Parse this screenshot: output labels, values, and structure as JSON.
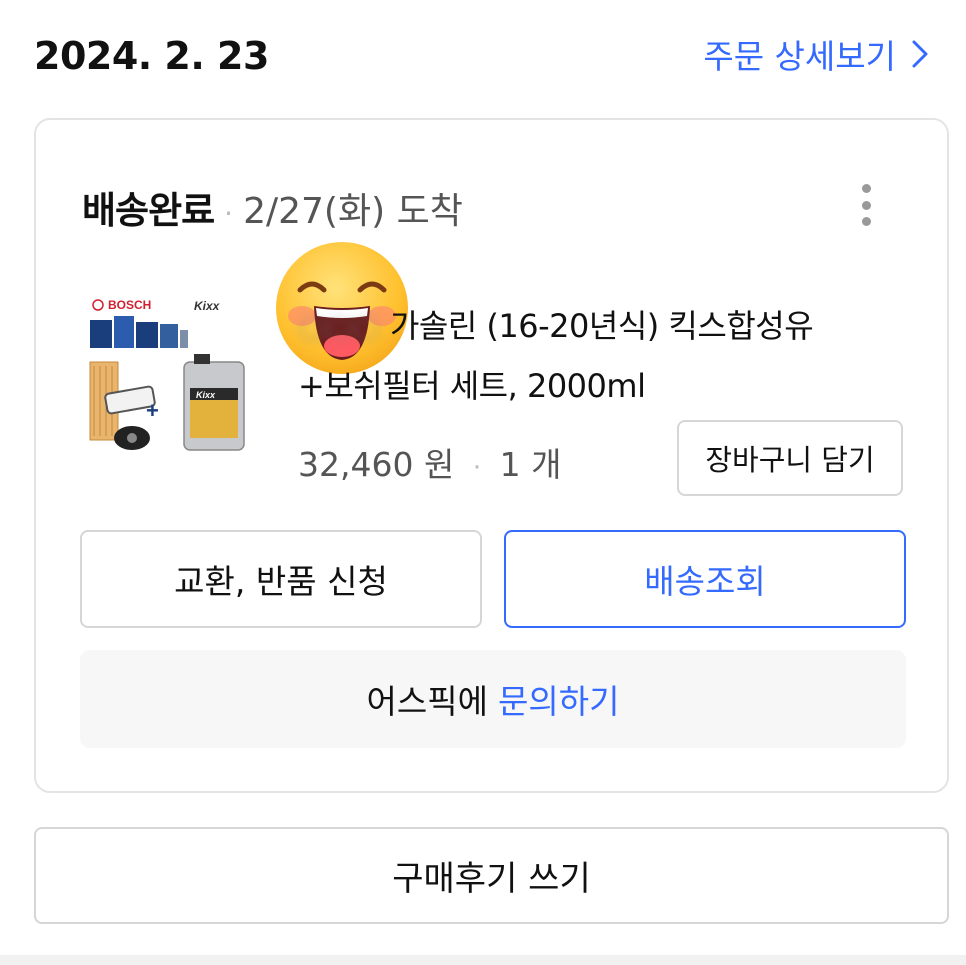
{
  "order": {
    "date": "2024. 2. 23",
    "detail_link": "주문 상세보기"
  },
  "shipment": {
    "status": "배송완료",
    "separator": "·",
    "arrival": "2/27(화) 도착"
  },
  "product": {
    "name_blurred": "○○○",
    "name_line1": "가솔린 (16-20년식) 킥스합성유",
    "name_line2": "+보쉬필터 세트, 2000ml",
    "price": "32,460 원",
    "quantity": "1 개",
    "image_brand_left": "BOSCH",
    "image_brand_right": "Kixx",
    "image_brand_small": "Kixx"
  },
  "buttons": {
    "add_to_cart": "장바구니 담기",
    "return_exchange": "교환, 반품 신청",
    "track_delivery": "배송조회",
    "inquiry_prefix": "어스픽에",
    "inquiry_link": "문의하기",
    "write_review": "구매후기 쓰기"
  },
  "colors": {
    "accent": "#346aff",
    "border": "#d6d6d6",
    "inquiry_bg": "#f7f7f8"
  },
  "icons": {
    "detail_arrow": "chevron-right-icon",
    "more_menu": "kebab-menu-icon",
    "sticker": "grinning-face-emoji"
  }
}
